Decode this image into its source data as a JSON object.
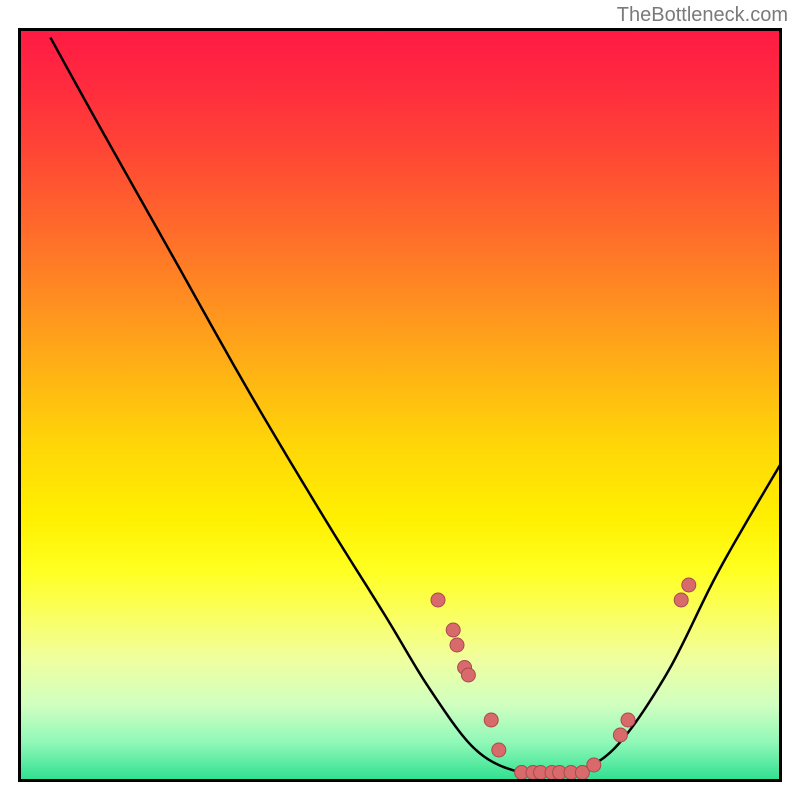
{
  "attribution": "TheBottleneck.com",
  "chart_data": {
    "type": "line",
    "title": "",
    "xlabel": "",
    "ylabel": "",
    "xlim": [
      0,
      100
    ],
    "ylim": [
      0,
      100
    ],
    "curve": [
      {
        "x": 4,
        "y": 99
      },
      {
        "x": 10,
        "y": 88
      },
      {
        "x": 20,
        "y": 70
      },
      {
        "x": 30,
        "y": 52
      },
      {
        "x": 40,
        "y": 35
      },
      {
        "x": 48,
        "y": 22
      },
      {
        "x": 54,
        "y": 12
      },
      {
        "x": 60,
        "y": 4
      },
      {
        "x": 66,
        "y": 1
      },
      {
        "x": 72,
        "y": 1
      },
      {
        "x": 78,
        "y": 4
      },
      {
        "x": 85,
        "y": 14
      },
      {
        "x": 92,
        "y": 28
      },
      {
        "x": 100,
        "y": 42
      }
    ],
    "markers": [
      {
        "x": 55,
        "y": 24
      },
      {
        "x": 57,
        "y": 20
      },
      {
        "x": 57.5,
        "y": 18
      },
      {
        "x": 58.5,
        "y": 15
      },
      {
        "x": 59,
        "y": 14
      },
      {
        "x": 62,
        "y": 8
      },
      {
        "x": 63,
        "y": 4
      },
      {
        "x": 66,
        "y": 1
      },
      {
        "x": 67.5,
        "y": 1
      },
      {
        "x": 68.5,
        "y": 1
      },
      {
        "x": 70,
        "y": 1
      },
      {
        "x": 71,
        "y": 1
      },
      {
        "x": 72.5,
        "y": 1
      },
      {
        "x": 74,
        "y": 1
      },
      {
        "x": 75.5,
        "y": 2
      },
      {
        "x": 79,
        "y": 6
      },
      {
        "x": 80,
        "y": 8
      },
      {
        "x": 87,
        "y": 24
      },
      {
        "x": 88,
        "y": 26
      }
    ],
    "gradient_stops": [
      {
        "offset": 0.0,
        "color": "#ff1a44"
      },
      {
        "offset": 0.07,
        "color": "#ff2a3f"
      },
      {
        "offset": 0.15,
        "color": "#ff4236"
      },
      {
        "offset": 0.25,
        "color": "#ff652c"
      },
      {
        "offset": 0.35,
        "color": "#ff8a22"
      },
      {
        "offset": 0.45,
        "color": "#ffb015"
      },
      {
        "offset": 0.55,
        "color": "#ffd508"
      },
      {
        "offset": 0.65,
        "color": "#fff000"
      },
      {
        "offset": 0.72,
        "color": "#ffff20"
      },
      {
        "offset": 0.78,
        "color": "#faff60"
      },
      {
        "offset": 0.84,
        "color": "#efffa0"
      },
      {
        "offset": 0.9,
        "color": "#d0ffc0"
      },
      {
        "offset": 0.95,
        "color": "#90f8b8"
      },
      {
        "offset": 1.0,
        "color": "#2fe090"
      }
    ],
    "marker_color": "#d96a6c",
    "marker_stroke": "#a84a4c"
  }
}
